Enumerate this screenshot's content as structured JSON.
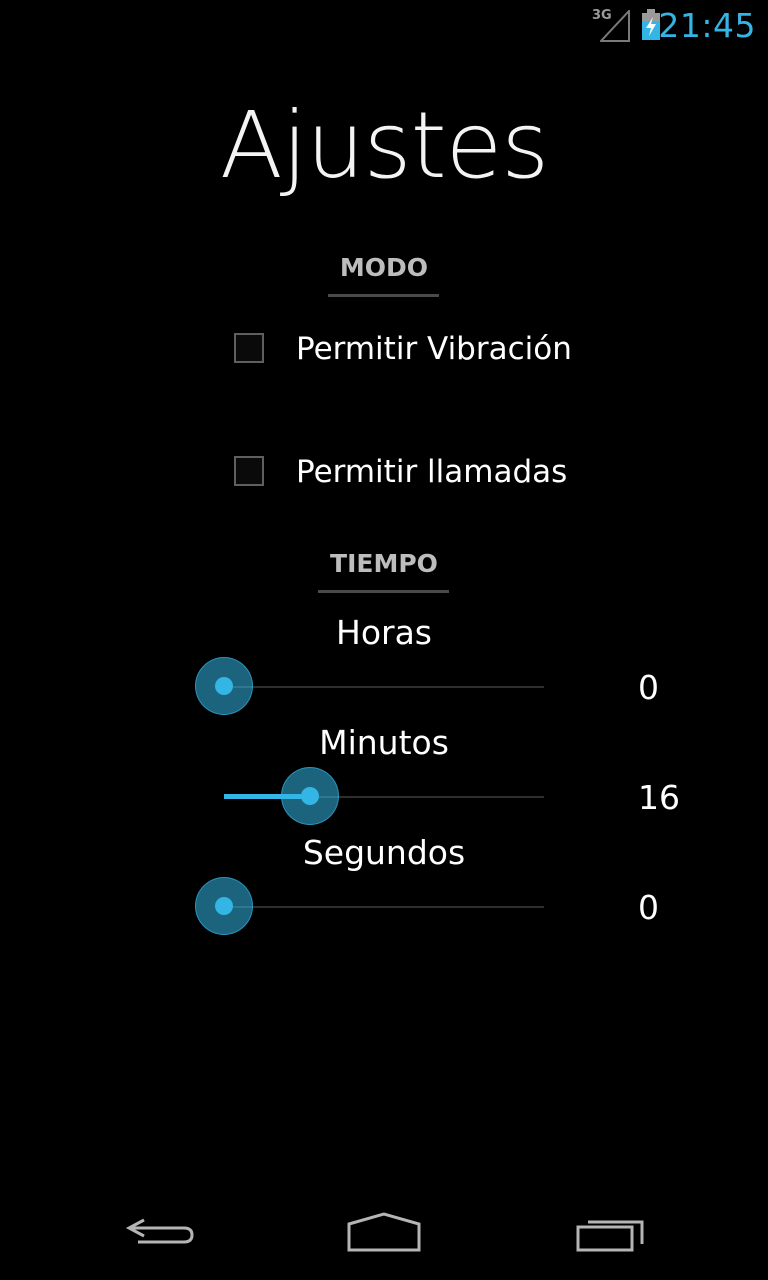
{
  "status_bar": {
    "network_type": "3G",
    "time": "21:45",
    "icons": [
      "signal-icon",
      "battery-charging-icon"
    ]
  },
  "title": "Ajustes",
  "sections": {
    "modo": {
      "header": "MODO",
      "options": [
        {
          "label": "Permitir Vibración",
          "checked": false
        },
        {
          "label": "Permitir llamadas",
          "checked": false
        }
      ]
    },
    "tiempo": {
      "header": "TIEMPO",
      "sliders": [
        {
          "label": "Horas",
          "value": "0",
          "fraction": 0.0
        },
        {
          "label": "Minutos",
          "value": "16",
          "fraction": 0.27
        },
        {
          "label": "Segundos",
          "value": "0",
          "fraction": 0.0
        }
      ]
    }
  },
  "nav_bar": {
    "icons": [
      "back-icon",
      "home-icon",
      "recents-icon"
    ]
  },
  "colors": {
    "accent": "#33b5e5",
    "background": "#000000",
    "header_text": "#bdbdbd"
  }
}
